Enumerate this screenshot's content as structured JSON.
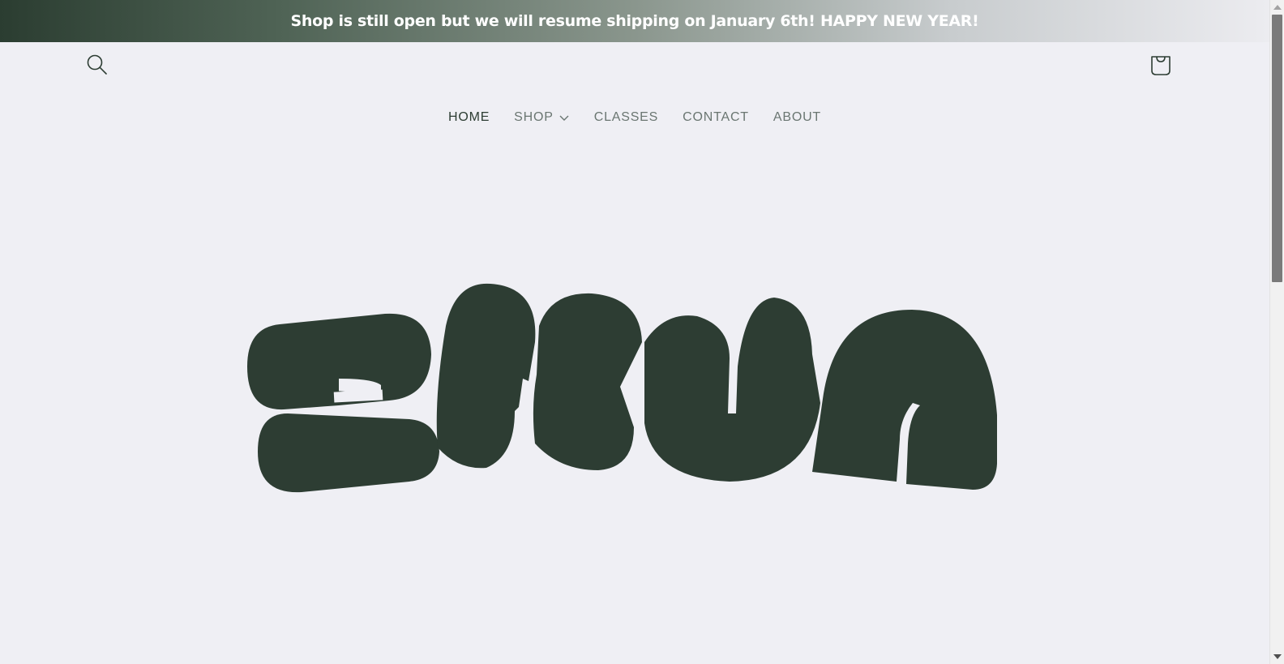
{
  "announcement": {
    "text": "Shop is still open but we will resume shipping on January 6th! HAPPY NEW YEAR!"
  },
  "header": {
    "search_icon": "search-icon",
    "cart_icon": "cart-bag-icon"
  },
  "nav": {
    "items": [
      {
        "label": "HOME",
        "active": true
      },
      {
        "label": "SHOP",
        "has_dropdown": true
      },
      {
        "label": "CLASSES"
      },
      {
        "label": "CONTACT"
      },
      {
        "label": "ABOUT"
      }
    ]
  },
  "hero": {
    "logo_text": "EKUA",
    "logo_color": "#2d3d33"
  },
  "colors": {
    "background": "#efeff4",
    "accent": "#2d3d33",
    "nav_text": "#6a7671"
  }
}
